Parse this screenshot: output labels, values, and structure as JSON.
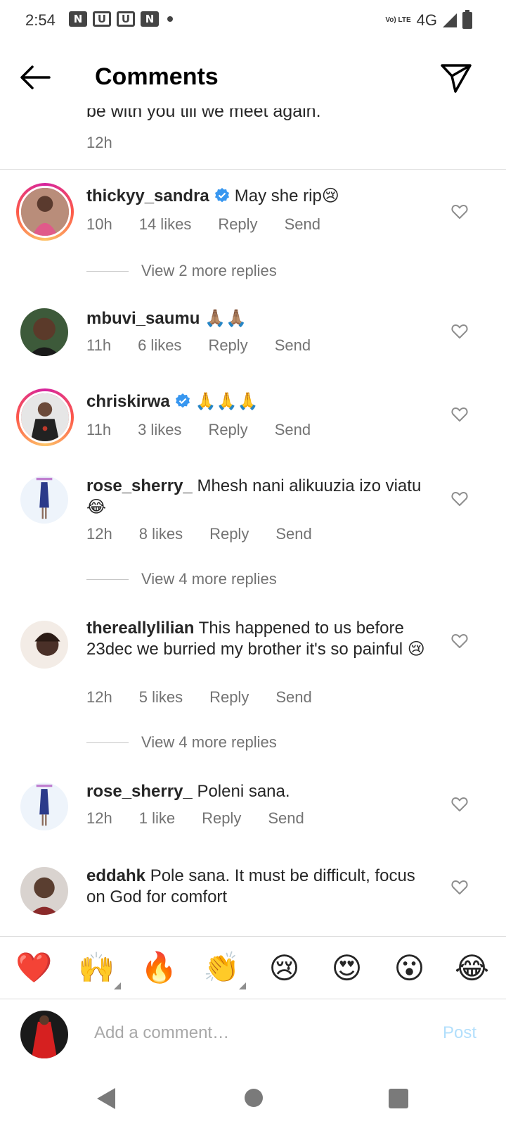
{
  "status": {
    "time": "2:54",
    "app_glyphs": [
      "N",
      "U",
      "U",
      "N"
    ],
    "volte": "Vo) LTE",
    "network": "4G"
  },
  "header": {
    "title": "Comments"
  },
  "caption": {
    "tail_text": "be with you till we meet again.",
    "time": "12h"
  },
  "comments": [
    {
      "username": "thickyy_sandra",
      "verified": true,
      "text": "May she rip😢",
      "time": "10h",
      "likes": "14 likes",
      "reply": "Reply",
      "send": "Send",
      "view_replies": "View 2 more replies"
    },
    {
      "username": "mbuvi_saumu",
      "verified": false,
      "text": "🙏🏽🙏🏽",
      "time": "11h",
      "likes": "6 likes",
      "reply": "Reply",
      "send": "Send"
    },
    {
      "username": "chriskirwa",
      "verified": true,
      "text": "🙏🙏🙏",
      "time": "11h",
      "likes": "3 likes",
      "reply": "Reply",
      "send": "Send"
    },
    {
      "username": "rose_sherry_",
      "verified": false,
      "text": "Mhesh nani alikuuzia izo viatu 😂",
      "time": "12h",
      "likes": "8 likes",
      "reply": "Reply",
      "send": "Send",
      "view_replies": "View 4 more replies"
    },
    {
      "username": "thereallylilian",
      "verified": false,
      "text": "This happened to us before 23dec we burried my brother it's so painful 😢",
      "time": "12h",
      "likes": "5 likes",
      "reply": "Reply",
      "send": "Send",
      "view_replies": "View 4 more replies"
    },
    {
      "username": "rose_sherry_",
      "verified": false,
      "text": "Poleni sana.",
      "time": "12h",
      "likes": "1 like",
      "reply": "Reply",
      "send": "Send"
    },
    {
      "username": "eddahk",
      "verified": false,
      "text": "Pole sana. It must be difficult, focus on God for comfort"
    }
  ],
  "reactions": [
    "❤️",
    "🙌",
    "🔥",
    "👏",
    "😢",
    "😍",
    "😮",
    "😂"
  ],
  "composer": {
    "placeholder": "Add a comment…",
    "post_label": "Post"
  },
  "colors": {
    "verified": "#3897f0",
    "post_disabled": "#b2dffc",
    "meta_text": "#737373"
  }
}
